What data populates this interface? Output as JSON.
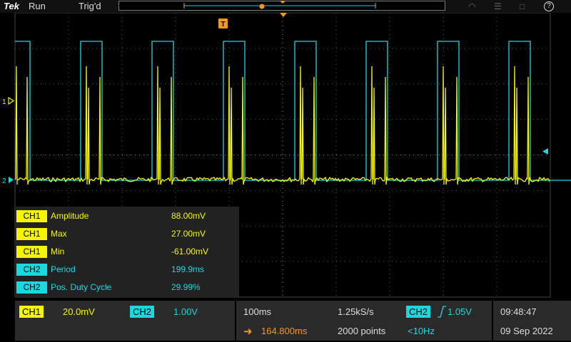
{
  "top": {
    "logo": "Tek",
    "run_state": "Run",
    "trigger_state": "Trig'd",
    "help_glyph": "?"
  },
  "markers": {
    "trigger_label": "T",
    "ch1_marker": "1",
    "ch2_marker": "2"
  },
  "measurements": [
    {
      "channel": "CH1",
      "name": "Amplitude",
      "value": "88.00mV",
      "color": "#f5f500"
    },
    {
      "channel": "CH1",
      "name": "Max",
      "value": "27.00mV",
      "color": "#f5f500"
    },
    {
      "channel": "CH1",
      "name": "Min",
      "value": "-61.00mV",
      "color": "#f5f500"
    },
    {
      "channel": "CH2",
      "name": "Period",
      "value": "199.9ms",
      "color": "#18d8e0"
    },
    {
      "channel": "CH2",
      "name": "Pos. Duty Cycle",
      "value": "29.99%",
      "color": "#18d8e0"
    }
  ],
  "bottom": {
    "ch1_label": "CH1",
    "ch1_scale": "20.0mV",
    "ch2_label": "CH2",
    "ch2_scale": "1.00V",
    "timebase": "100ms",
    "sample_rate": "1.25kS/s",
    "h_position": "164.800ms",
    "record_length": "2000 points",
    "trig_source": "CH2",
    "trig_level": "1.05V",
    "trig_freq": "<10Hz",
    "time": "09:48:47",
    "date": "09 Sep 2022"
  },
  "colors": {
    "ch1": "#f5f500",
    "ch2": "#18d8e0",
    "accent": "#f39a1e",
    "graticule": "#555555"
  }
}
